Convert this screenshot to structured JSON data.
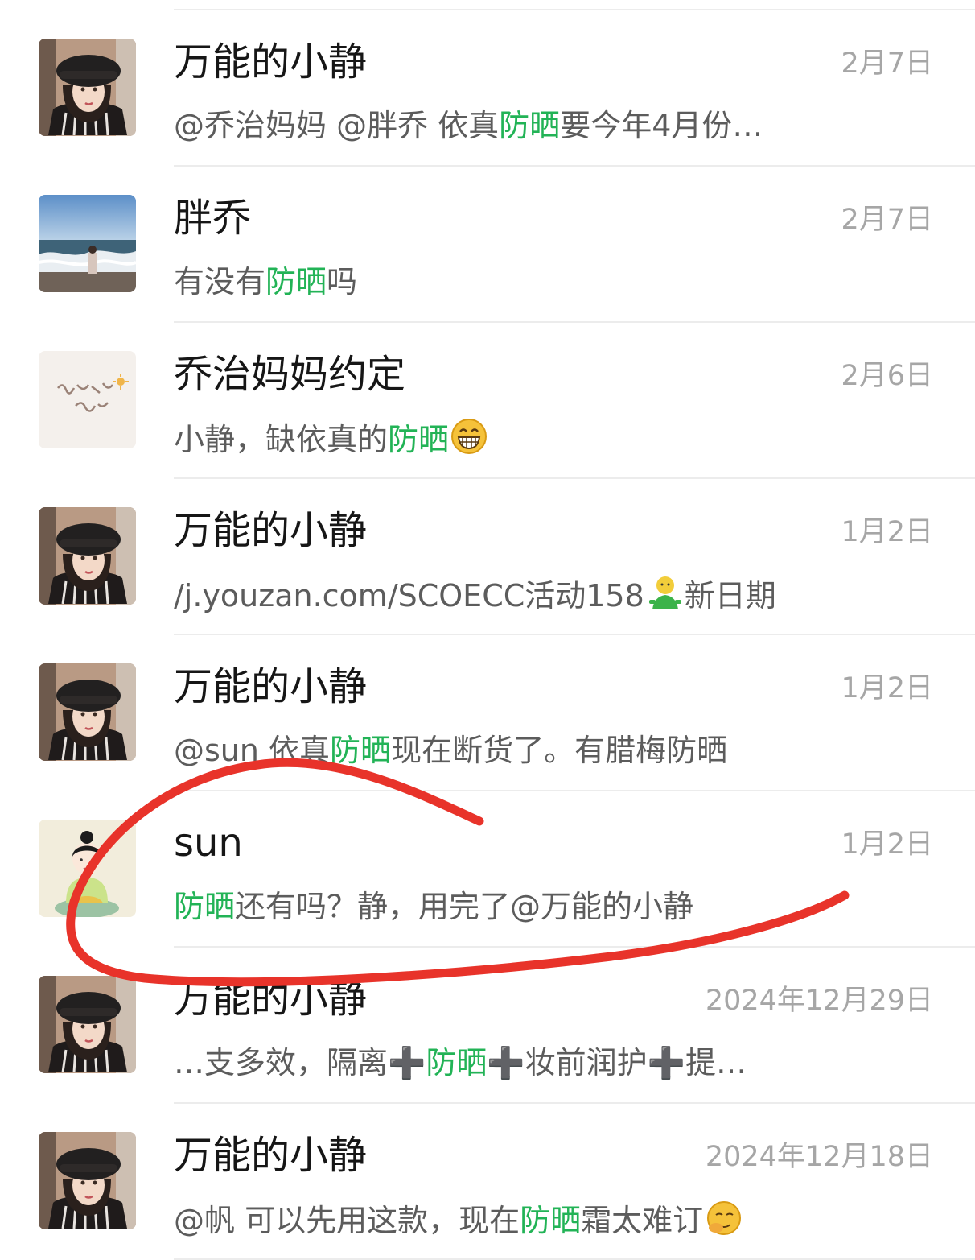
{
  "highlight_color": "#22b356",
  "annotation_color": "#e8332a",
  "results": [
    {
      "avatar": "woman-beret-avatar",
      "name": "万能的小静",
      "date": "2月7日",
      "msg_before": "@乔治妈妈 @胖乔 依真",
      "msg_highlight": "防晒",
      "msg_after": "要今年4月份…",
      "emoji": ""
    },
    {
      "avatar": "seaside-avatar",
      "name": "胖乔",
      "date": "2月7日",
      "msg_before": "有没有",
      "msg_highlight": "防晒",
      "msg_after": "吗",
      "emoji": ""
    },
    {
      "avatar": "calligraphy-avatar",
      "name": "乔治妈妈约定",
      "date": "2月6日",
      "msg_before": "小静，缺依真的",
      "msg_highlight": "防晒",
      "msg_after": "",
      "emoji": "grin-emoji"
    },
    {
      "avatar": "woman-beret-avatar",
      "name": "万能的小静",
      "date": "1月2日",
      "msg_before": "/j.youzan.com/SCOECC活动158",
      "msg_highlight": "",
      "msg_after": "新日期",
      "emoji": "mini-figure-emoji"
    },
    {
      "avatar": "woman-beret-avatar",
      "name": "万能的小静",
      "date": "1月2日",
      "msg_before": "@sun 依真",
      "msg_highlight": "防晒",
      "msg_after": "现在断货了。有腊梅防晒",
      "emoji": ""
    },
    {
      "avatar": "cartoon-girl-avatar",
      "name": "sun",
      "date": "1月2日",
      "msg_before": "",
      "msg_highlight": "防晒",
      "msg_after": "还有吗？静，用完了@万能的小静",
      "emoji": ""
    },
    {
      "avatar": "woman-beret-avatar",
      "name": "万能的小静",
      "date": "2024年12月29日",
      "msg_before": "…支多效，隔离➕",
      "msg_highlight": "防晒",
      "msg_after": "➕妆前润护➕提…",
      "emoji": ""
    },
    {
      "avatar": "woman-beret-avatar",
      "name": "万能的小静",
      "date": "2024年12月18日",
      "msg_before": "@帆 可以先用这款，现在",
      "msg_highlight": "防晒",
      "msg_after": "霜太难订",
      "emoji": "facepalm-emoji"
    }
  ]
}
